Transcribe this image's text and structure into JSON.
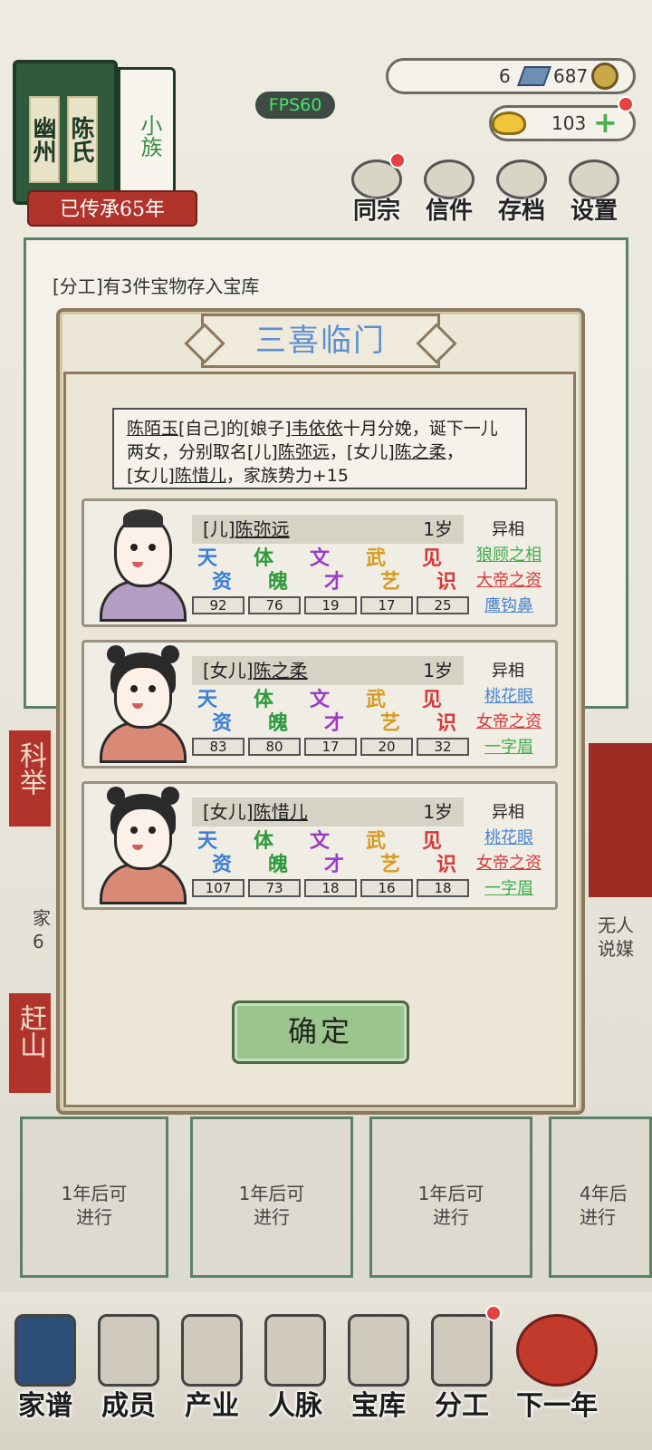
{
  "clan": {
    "region": "幽州",
    "surname": "陈氏",
    "rank": "小族",
    "heritage": "已传承65年"
  },
  "fps": "FPS60",
  "resources": {
    "silver": "6",
    "coins": "687",
    "gold": "103"
  },
  "top_nav": [
    "同宗",
    "信件",
    "存档",
    "设置"
  ],
  "log": "[分工]有3件宝物存入宝库",
  "side_tiles": [
    "科举",
    "赶山"
  ],
  "bg_cards": [
    "1年后可\n进行",
    "1年后可\n进行",
    "1年后可\n进行",
    "4年后\n进行"
  ],
  "bg_right_text": "无人\n说媒",
  "bg_left_text": "家\n6",
  "bottom_nav": [
    "家谱",
    "成员",
    "产业",
    "人脉",
    "宝库",
    "分工",
    "下一年"
  ],
  "dialog": {
    "title": "三喜临门",
    "message_parts": {
      "a": "陈陌玉",
      "b": "[自己]的[娘子]",
      "c": "韦依依",
      "d": "十月分娩，诞下一儿两女，分别取名[儿]",
      "e": "陈弥远",
      "f": "，[女儿]",
      "g": "陈之柔",
      "h": "，",
      "i": "[女儿]",
      "j": "陈惜儿",
      "k": "，家族势力+15"
    },
    "attr_labels": [
      {
        "c1": "天",
        "c2": "资",
        "color": "#3d7fd6"
      },
      {
        "c1": "体",
        "c2": "魄",
        "color": "#2f9a3c"
      },
      {
        "c1": "文",
        "c2": "才",
        "color": "#9b3bc8"
      },
      {
        "c1": "武",
        "c2": "艺",
        "color": "#d69b1e"
      },
      {
        "c1": "见",
        "c2": "识",
        "color": "#d43a3a"
      }
    ],
    "trait_header": "异相",
    "children": [
      {
        "prefix": "[儿]",
        "name": "陈弥远",
        "age": "1岁",
        "gender": "boy",
        "stats": [
          "92",
          "76",
          "19",
          "17",
          "25"
        ],
        "traits": [
          {
            "text": "狼顾之相",
            "color": "#3fae4b"
          },
          {
            "text": "大帝之资",
            "color": "#d43a3a"
          },
          {
            "text": "鹰钩鼻",
            "color": "#4a85d0"
          }
        ]
      },
      {
        "prefix": "[女儿]",
        "name": "陈之柔",
        "age": "1岁",
        "gender": "girl",
        "stats": [
          "83",
          "80",
          "17",
          "20",
          "32"
        ],
        "traits": [
          {
            "text": "桃花眼",
            "color": "#4a85d0"
          },
          {
            "text": "女帝之资",
            "color": "#d43a3a"
          },
          {
            "text": "一字眉",
            "color": "#3fae4b"
          }
        ]
      },
      {
        "prefix": "[女儿]",
        "name": "陈惜儿",
        "age": "1岁",
        "gender": "girl",
        "stats": [
          "107",
          "73",
          "18",
          "16",
          "18"
        ],
        "traits": [
          {
            "text": "桃花眼",
            "color": "#4a85d0"
          },
          {
            "text": "女帝之资",
            "color": "#d43a3a"
          },
          {
            "text": "一字眉",
            "color": "#3fae4b"
          }
        ]
      }
    ],
    "confirm": "确定"
  }
}
